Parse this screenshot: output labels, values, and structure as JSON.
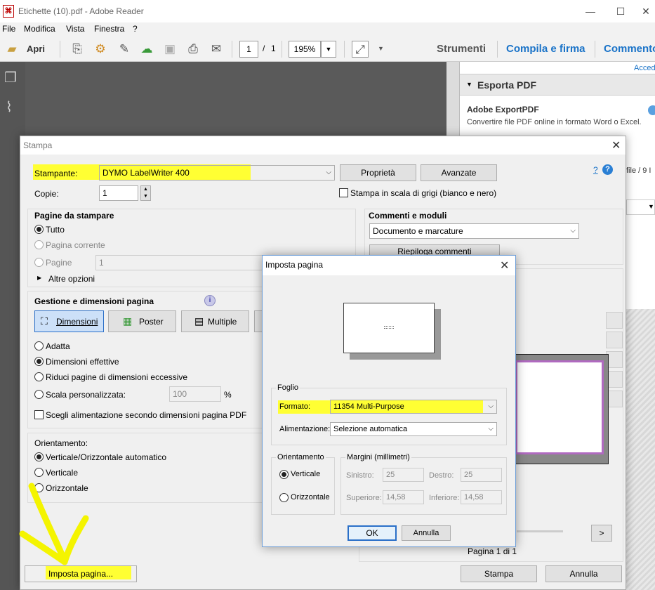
{
  "window": {
    "title": "Etichette (10).pdf - Adobe Reader",
    "controls": {
      "minimize": "—",
      "maximize": "☐",
      "close": "✕"
    }
  },
  "menu": [
    "File",
    "Modifica",
    "Vista",
    "Finestra",
    "?"
  ],
  "toolbar": {
    "open_label": "Apri",
    "page_current": "1",
    "page_sep": "/",
    "page_total": "1",
    "zoom": "195%",
    "tabs": [
      "Strumenti",
      "Compila e firma",
      "Commento"
    ]
  },
  "right_panel": {
    "link": "Acced",
    "section_title": "Esporta PDF",
    "export_title": "Adobe ExportPDF",
    "export_desc": "Convertire file PDF online in formato Word o Excel.",
    "file_info": "file / 9 I"
  },
  "stampa": {
    "title": "Stampa",
    "printer_label": "Stampante:",
    "printer_value": "DYMO LabelWriter 400",
    "properties_btn": "Proprietà",
    "advanced_btn": "Avanzate",
    "help_q": "?",
    "copies_label": "Copie:",
    "copies_value": "1",
    "grayscale_label": "Stampa in scala di grigi (bianco e nero)",
    "pages_section": "Pagine da stampare",
    "pages_all": "Tutto",
    "pages_current": "Pagina corrente",
    "pages_range": "Pagine",
    "pages_range_value": "1",
    "more_options": "Altre opzioni",
    "sizing_section": "Gestione e dimensioni pagina",
    "tab_size": "Dimensioni",
    "tab_poster": "Poster",
    "tab_multiple": "Multiple",
    "fit": "Adatta",
    "actual": "Dimensioni effettive",
    "shrink": "Riduci pagine di dimensioni eccessive",
    "custom_scale": "Scala personalizzata:",
    "custom_scale_value": "100",
    "percent": "%",
    "choose_source": "Scegli alimentazione secondo dimensioni pagina PDF",
    "orientation_label": "Orientamento:",
    "orient_auto": "Verticale/Orizzontale automatico",
    "orient_portrait": "Verticale",
    "orient_landscape": "Orizzontale",
    "comments_section": "Commenti e moduli",
    "comments_value": "Documento e marcature",
    "summarize_btn": "Riepiloga commenti",
    "page_count": "Pagina 1 di 1",
    "next_btn": ">",
    "page_setup_btn": "Imposta pagina...",
    "print_btn": "Stampa",
    "cancel_btn": "Annulla"
  },
  "imposta": {
    "title": "Imposta pagina",
    "sheet_group": "Foglio",
    "format_label": "Formato:",
    "format_value": "11354 Multi-Purpose",
    "source_label": "Alimentazione:",
    "source_value": "Selezione automatica",
    "orient_group": "Orientamento",
    "orient_portrait": "Verticale",
    "orient_landscape": "Orizzontale",
    "margins_group": "Margini (millimetri)",
    "left_label": "Sinistro:",
    "left_value": "25",
    "right_label": "Destro:",
    "right_value": "25",
    "top_label": "Superiore:",
    "top_value": "14,58",
    "bottom_label": "Inferiore:",
    "bottom_value": "14,58",
    "ok_btn": "OK",
    "cancel_btn": "Annulla"
  },
  "colors": {
    "highlight": "#ffff33",
    "accent": "#1a73c8",
    "preview_border": "#b06ac0"
  }
}
